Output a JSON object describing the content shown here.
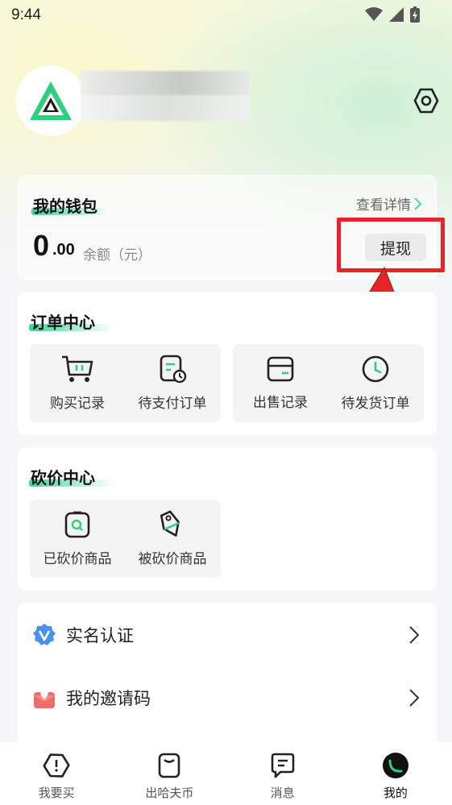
{
  "status_bar": {
    "time": "9:44"
  },
  "wallet": {
    "title": "我的钱包",
    "detail_link": "查看详情",
    "balance_int": "0",
    "balance_dec": ".00",
    "balance_label": "余额（元）",
    "withdraw_label": "提现"
  },
  "order_center": {
    "title": "订单中心",
    "items": [
      {
        "label": "购买记录",
        "icon": "cart-icon"
      },
      {
        "label": "待支付订单",
        "icon": "pending-payment-icon"
      },
      {
        "label": "出售记录",
        "icon": "wallet-icon"
      },
      {
        "label": "待发货订单",
        "icon": "clock-icon"
      }
    ]
  },
  "bargain_center": {
    "title": "砍价中心",
    "items": [
      {
        "label": "已砍价商品",
        "icon": "bargained-goods-icon"
      },
      {
        "label": "被砍价商品",
        "icon": "price-tag-icon"
      }
    ]
  },
  "menu": {
    "items": [
      {
        "label": "实名认证",
        "icon": "verified-badge-icon"
      },
      {
        "label": "我的邀请码",
        "icon": "invite-gift-icon"
      }
    ]
  },
  "bottom_nav": {
    "items": [
      {
        "label": "我要买",
        "icon": "buy-icon",
        "active": false
      },
      {
        "label": "出哈夫币",
        "icon": "sell-bag-icon",
        "active": false
      },
      {
        "label": "消息",
        "icon": "message-icon",
        "active": false
      },
      {
        "label": "我的",
        "icon": "profile-icon",
        "active": true
      }
    ]
  },
  "colors": {
    "accent_green": "#3ed29a",
    "highlight_red": "#e8242a",
    "background": "#f5f6f8"
  }
}
